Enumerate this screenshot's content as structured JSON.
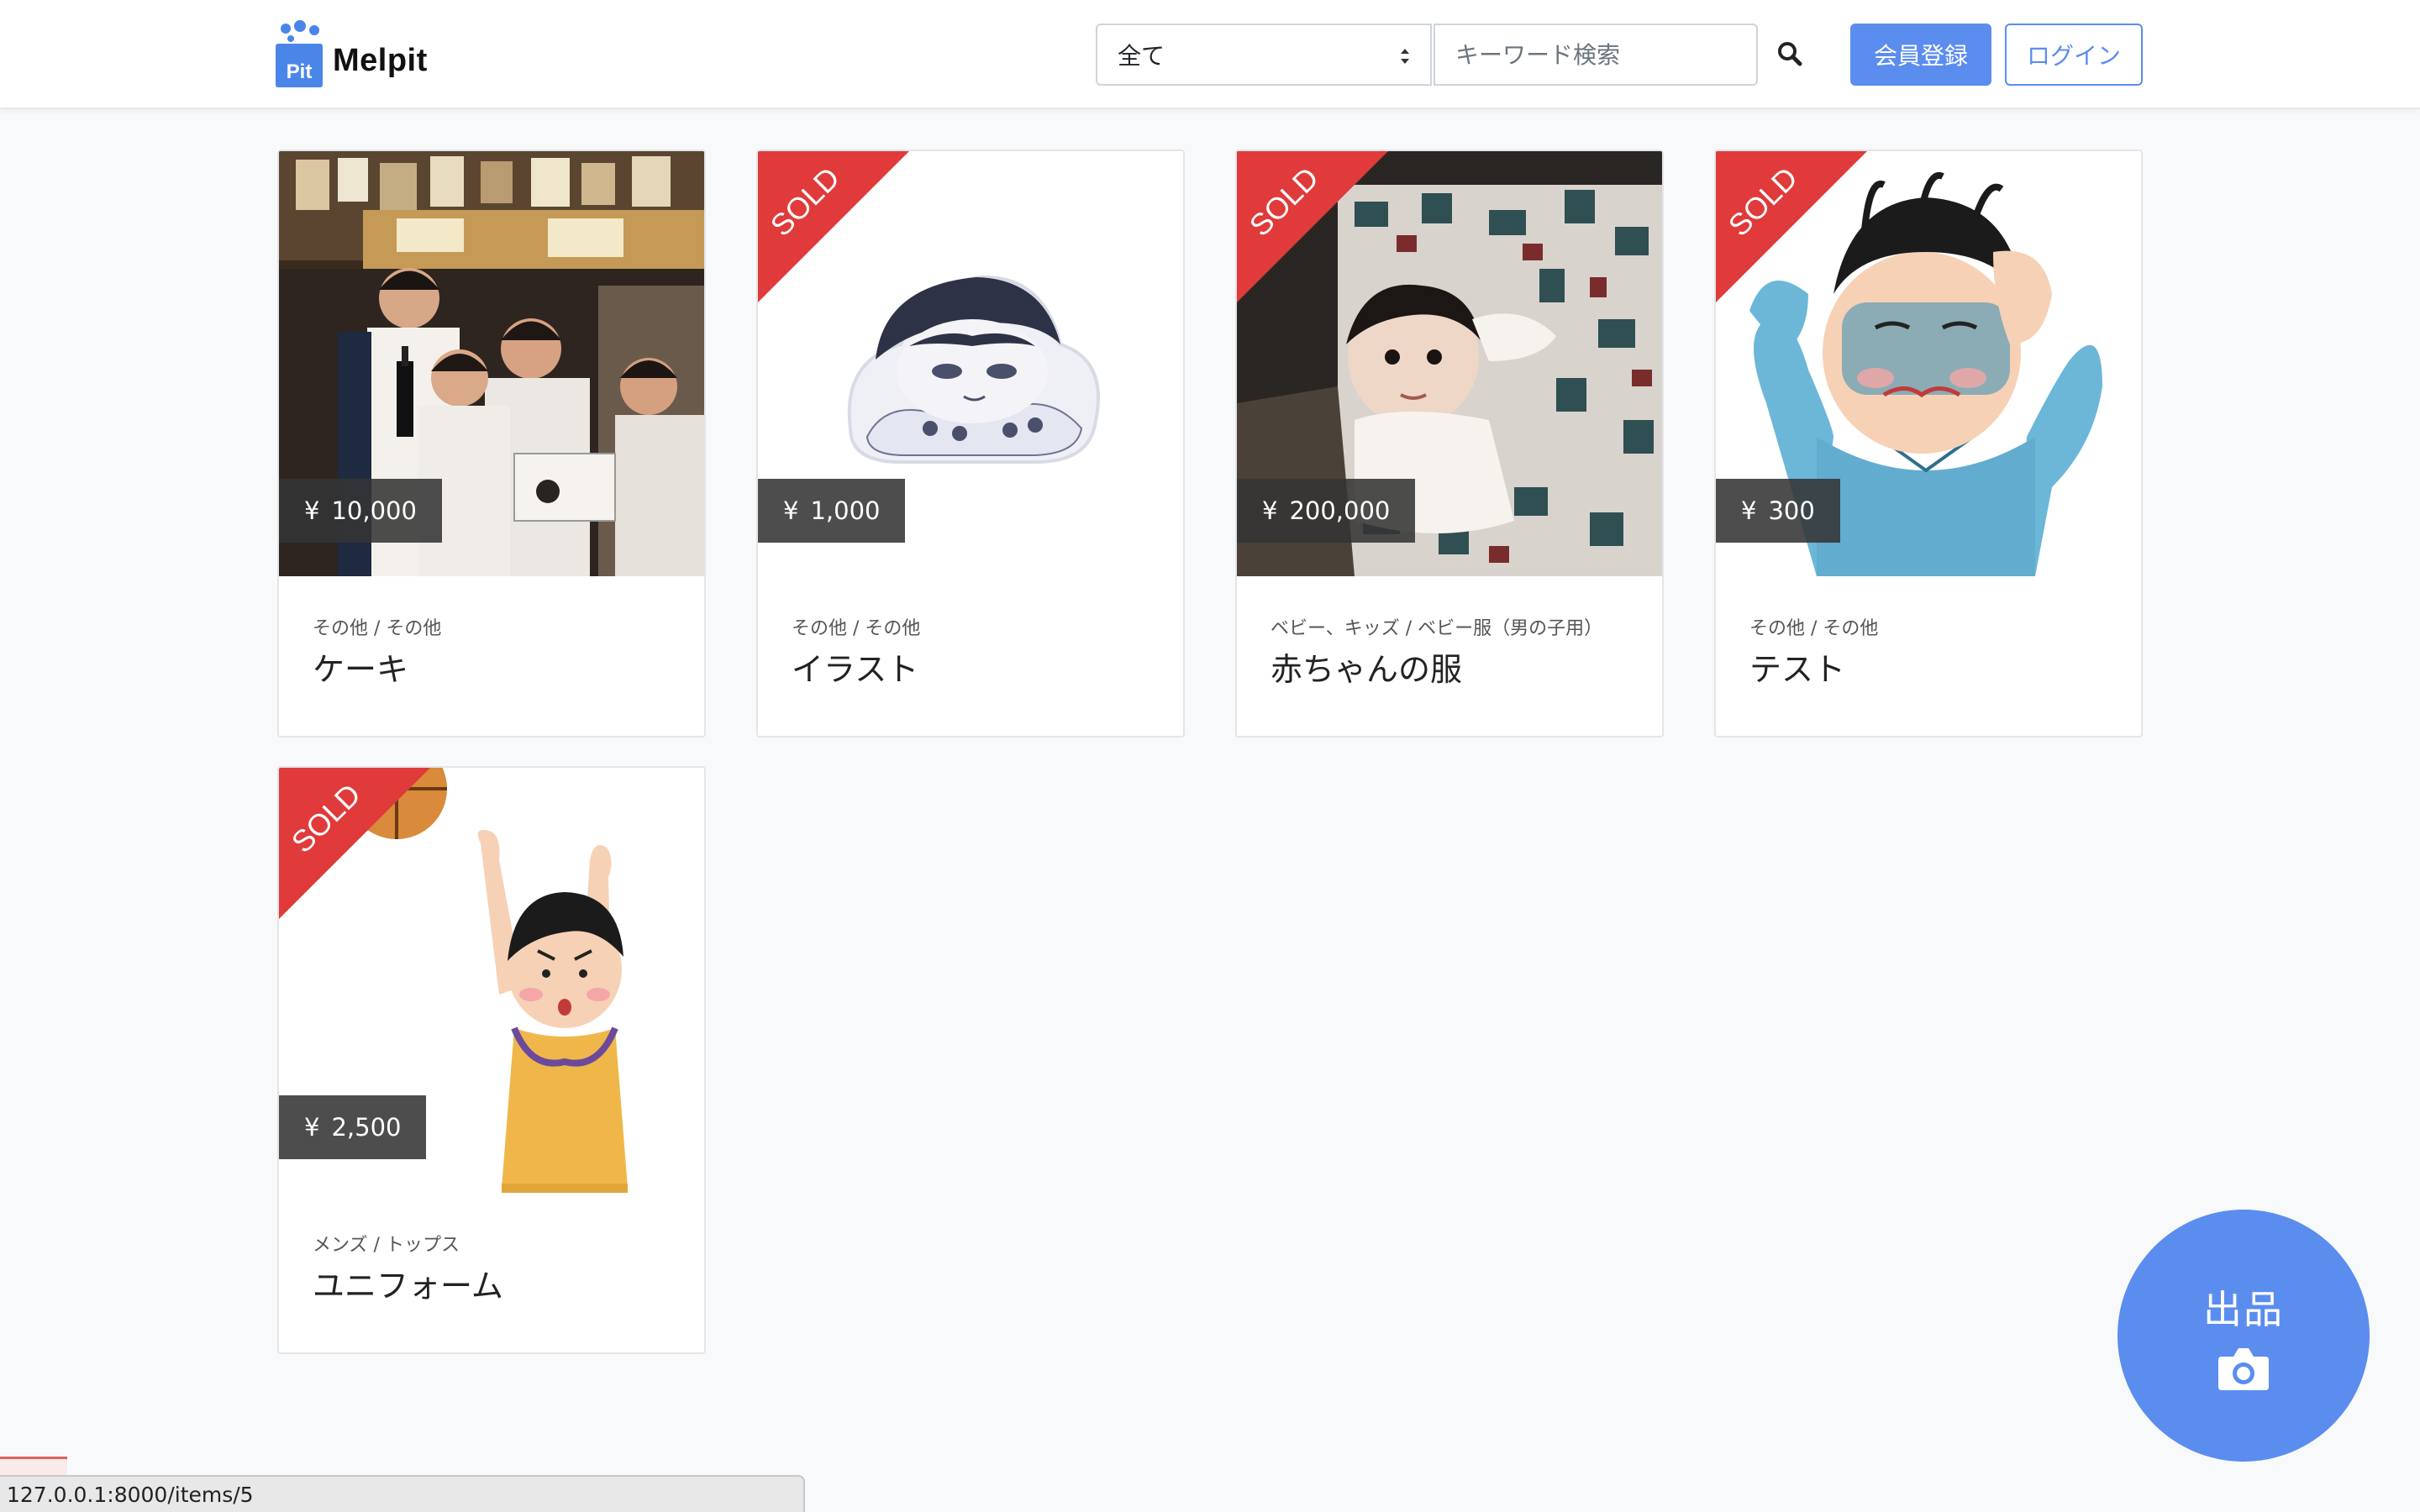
{
  "brand": {
    "name": "Melpit",
    "logo_text": "Pit",
    "color": "#4a86e8"
  },
  "header": {
    "category_select": {
      "selected": "全て"
    },
    "search": {
      "placeholder": "キーワード検索"
    },
    "register_label": "会員登録",
    "login_label": "ログイン",
    "accent_color": "#5b8def"
  },
  "items": [
    {
      "price": "10,000",
      "currency": "¥",
      "category": "その他 / その他",
      "name": "ケーキ",
      "sold": false,
      "image": "group-photo"
    },
    {
      "price": "1,000",
      "currency": "¥",
      "category": "その他 / その他",
      "name": "イラスト",
      "sold": true,
      "image": "illustration-sticker"
    },
    {
      "price": "200,000",
      "currency": "¥",
      "category": "ベビー、キッズ / ベビー服（男の子用）",
      "name": "赤ちゃんの服",
      "sold": true,
      "image": "baby-photo"
    },
    {
      "price": "300",
      "currency": "¥",
      "category": "その他 / その他",
      "name": "テスト",
      "sold": true,
      "image": "sick-boy-illustration"
    },
    {
      "price": "2,500",
      "currency": "¥",
      "category": "メンズ / トップス",
      "name": "ユニフォーム",
      "sold": true,
      "image": "basketball-player-illustration"
    }
  ],
  "sold_label": "SOLD",
  "sold_color": "#e03a3a",
  "fab": {
    "label": "出品",
    "icon": "camera-icon"
  },
  "status_bar": {
    "url": "127.0.0.1:8000/items/5"
  }
}
